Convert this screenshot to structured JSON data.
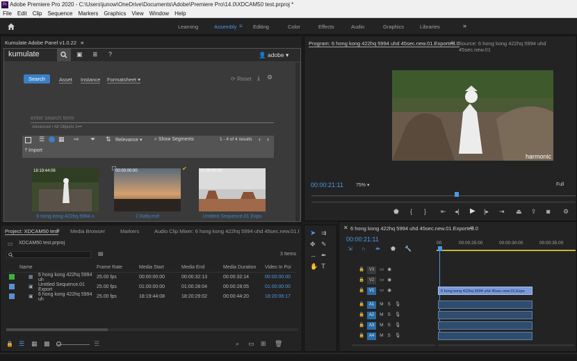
{
  "window": {
    "title": "Adobe Premiere Pro 2020 - C:\\Users\\junow\\OneDrive\\Documents\\Adobe\\Premiere Pro\\14.0\\XDCAM50 test.prproj *"
  },
  "menu": [
    "File",
    "Edit",
    "Clip",
    "Sequence",
    "Markers",
    "Graphics",
    "View",
    "Window",
    "Help"
  ],
  "workspaces": [
    {
      "label": "Learning",
      "active": false
    },
    {
      "label": "Assembly",
      "active": true
    },
    {
      "label": "Editing",
      "active": false
    },
    {
      "label": "Color",
      "active": false
    },
    {
      "label": "Effects",
      "active": false
    },
    {
      "label": "Audio",
      "active": false
    },
    {
      "label": "Graphics",
      "active": false
    },
    {
      "label": "Libraries",
      "active": false
    }
  ],
  "workspace_more": "»",
  "kumulate": {
    "panel_title": "Kumulate Adobe Panel v1.0.22",
    "logo": "kumulate",
    "user": "adobe",
    "search_button": "Search",
    "asset_tab": "Asset",
    "instance_tab": "Instance",
    "formatsheet": "Formatsheet",
    "reset": "Reset",
    "search_placeholder": "enter search term",
    "filter_hint": "Advanced  •  All Objects 1•••",
    "relevance": "Relevance",
    "show_segments": "Show Segments",
    "result_count": "1 - 4 of 4 results",
    "import": "Import",
    "thumbs": [
      {
        "tc": "18:19:44:08",
        "label": "6 hong kong 422hq 5994 u"
      },
      {
        "tc": "00:00:00:00",
        "label": "2 Rally.mxf"
      },
      {
        "tc": "01:00:00:00",
        "label": "Untitled Sequence.01 Expo"
      }
    ]
  },
  "program": {
    "tab": "Program: 6 hong kong 422hq 5994 uhd 45sec.new.01.Exported.0",
    "source_tab": "Source: 6 hong kong 422hq 5994 uhd 45sec.new.01",
    "watermark": "harmonic",
    "timecode": "00:00:21:11",
    "zoom": "75%",
    "quality": "Full",
    "playhead_fraction": 0.47
  },
  "project": {
    "tabs": [
      {
        "label": "Project: XDCAM50 test",
        "active": true
      },
      {
        "label": "Media Browser",
        "active": false
      },
      {
        "label": "Markers",
        "active": false
      },
      {
        "label": "Audio Clip Mixer: 6 hong kong 422hq 5994 uhd 45sec.new.01.E",
        "active": false
      }
    ],
    "file": "XDCAM50 test.prproj",
    "item_count": "3 Items",
    "columns": [
      "Name",
      "Frame Rate",
      "Media Start",
      "Media End",
      "Media Duration",
      "Video In Poi"
    ],
    "rows": [
      {
        "color": "#3fae3f",
        "name": "6 hong kong 422hq 5994 uh",
        "fr": "25.00 fps",
        "start": "00:00:00:00",
        "end": "00:00:32:13",
        "dur": "00:00:32:14",
        "vin": "00:00:00:00"
      },
      {
        "color": "#5a8fd0",
        "name": "Untitled Sequence.01 Export",
        "fr": "25.00 fps",
        "start": "01:00:00:00",
        "end": "01:00:28:04",
        "dur": "00:00:28:05",
        "vin": "01:00:00:00"
      },
      {
        "color": "#5a8fd0",
        "name": "6 hong kong 422hq 5994 uh",
        "fr": "25.00 fps",
        "start": "18:19:44:08",
        "end": "18:20:29:02",
        "dur": "00:00:44:20",
        "vin": "18:20:06:17"
      }
    ]
  },
  "timeline": {
    "tab": "6 hong kong 422hq 5994 uhd 45sec.new.01.Exported.0",
    "timecode": "00:00:21:11",
    "ruler": [
      "00",
      "00:00:25:00",
      "00:00:30:00",
      "00:00:35:00"
    ],
    "video_tracks": [
      "V3",
      "V2",
      "V1"
    ],
    "audio_tracks": [
      "A1",
      "A2",
      "A3",
      "A4"
    ],
    "clip_label": "6 hong kong 422hq 5994 uhd 45sec.new.01.Expo"
  }
}
